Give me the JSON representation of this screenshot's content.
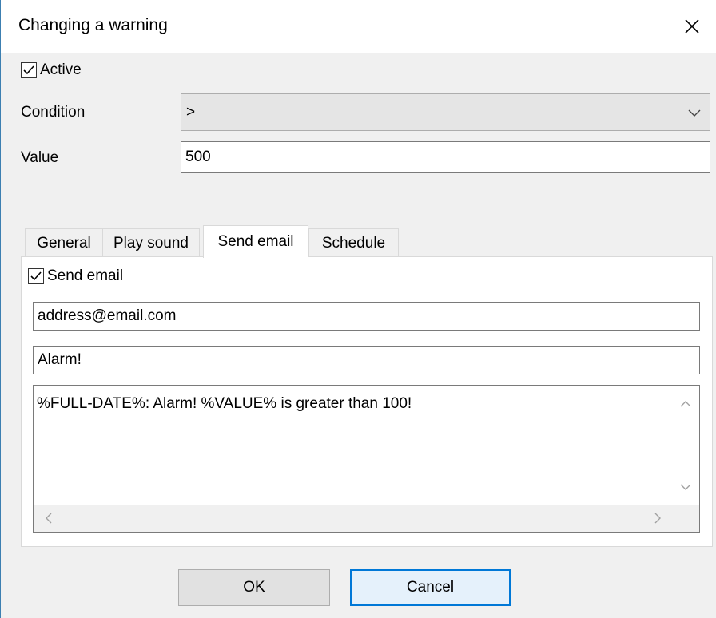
{
  "window": {
    "title": "Changing a warning"
  },
  "active": {
    "label": "Active",
    "checked": true
  },
  "condition": {
    "label": "Condition",
    "selected": ">"
  },
  "value": {
    "label": "Value",
    "text": "500"
  },
  "tabs": [
    {
      "label": "General"
    },
    {
      "label": "Play sound"
    },
    {
      "label": "Send email",
      "active": true
    },
    {
      "label": "Schedule"
    }
  ],
  "send_email": {
    "checkbox_label": "Send email",
    "checked": true,
    "address": "address@email.com",
    "subject": "Alarm!",
    "body": "%FULL-DATE%: Alarm! %VALUE% is greater than 100!"
  },
  "buttons": {
    "ok": "OK",
    "cancel": "Cancel"
  }
}
